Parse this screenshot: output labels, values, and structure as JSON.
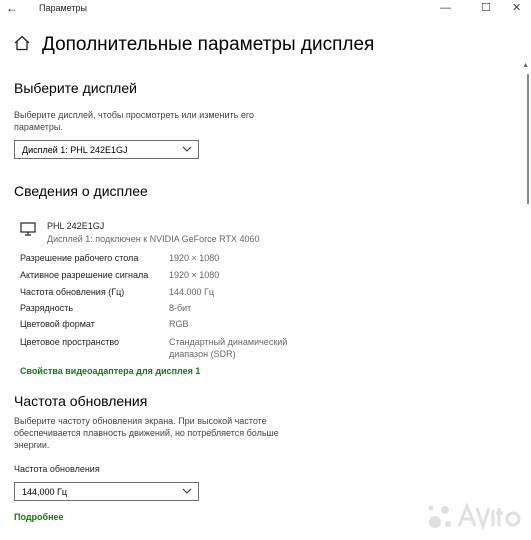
{
  "window": {
    "back_glyph": "←",
    "title": "Параметры",
    "minimize_glyph": "—",
    "maximize_glyph": "☐",
    "close_glyph": "✕"
  },
  "page": {
    "title": "Дополнительные параметры дисплея"
  },
  "select_display": {
    "heading": "Выберите дисплей",
    "description": "Выберите дисплей, чтобы просмотреть или изменить его параметры.",
    "dropdown_value": "Дисплей 1: PHL 242E1GJ"
  },
  "display_info": {
    "heading": "Сведения о дисплее",
    "monitor_name": "PHL 242E1GJ",
    "monitor_subtitle": "Дисплей 1: подключен к NVIDIA GeForce RTX 4060",
    "rows": [
      {
        "label": "Разрешение рабочего стола",
        "value": "1920 × 1080"
      },
      {
        "label": "Активное разрешение сигнала",
        "value": "1920 × 1080"
      },
      {
        "label": "Частота обновления (Гц)",
        "value": "144.000 Гц"
      },
      {
        "label": "Разрядность",
        "value": "8-бит"
      },
      {
        "label": "Цветовой формат",
        "value": "RGB"
      },
      {
        "label": "Цветовое пространство",
        "value": "Стандартный динамический диапазон (SDR)"
      }
    ],
    "adapter_link": "Свойства видеоадаптера для дисплея 1"
  },
  "refresh": {
    "heading": "Частота обновления",
    "description": "Выберите частоту обновления экрана. При высокой частоте обеспечивается плавность движений, но потребляется больше энергии.",
    "field_label": "Частота обновления",
    "dropdown_value": "144,000 Гц",
    "more_link": "Подробнее"
  },
  "colors": {
    "accent_link": "#107c10"
  }
}
